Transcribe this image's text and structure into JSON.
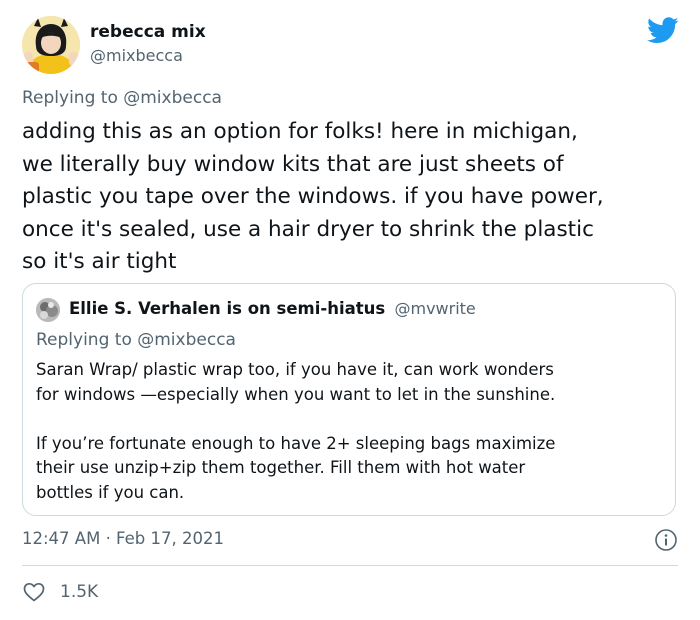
{
  "author": {
    "display_name": "rebecca mix",
    "handle": "@mixbecca",
    "avatar_icon": "user-avatar-photo"
  },
  "reply_context": {
    "prefix": "Replying to",
    "mention": "@mixbecca"
  },
  "tweet": {
    "text": "adding this as an option for folks! here in michigan,\nwe literally buy window kits that are just sheets of\nplastic you tape over the windows. if you have power,\nonce it's sealed, use a hair dryer to shrink the plastic\nso it's air tight"
  },
  "quoted_tweet": {
    "display_name": "Ellie S. Verhalen is on semi-hiatus",
    "handle": "@mvwrite",
    "reply_prefix": "Replying to",
    "reply_mention": "@mixbecca",
    "paragraphs": [
      "Saran Wrap/ plastic wrap too, if you have it, can work wonders\nfor windows —especially when you want to let in the sunshine.",
      "If you’re fortunate enough to have 2+ sleeping bags maximize\ntheir use unzip+zip them together. Fill them with hot water\nbottles if you can."
    ]
  },
  "meta": {
    "timestamp": "12:47 AM · Feb 17, 2021",
    "like_count": "1.5K"
  },
  "colors": {
    "twitter_blue": "#1d9bf0",
    "secondary_text": "#536471",
    "primary_text": "#0f1419",
    "border": "#cfd9de"
  }
}
